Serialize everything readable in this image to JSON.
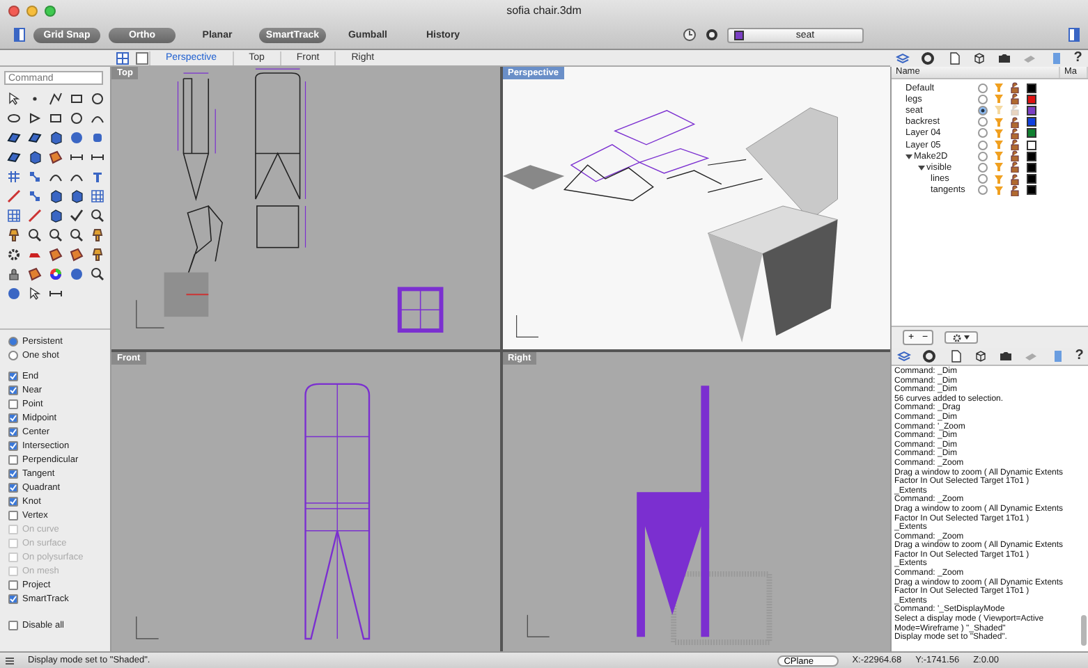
{
  "window": {
    "title": "sofia chair.3dm"
  },
  "toolbar": {
    "toggles": [
      {
        "label": "Grid Snap",
        "on": true
      },
      {
        "label": "Ortho",
        "on": true
      },
      {
        "label": "Planar",
        "on": false
      },
      {
        "label": "SmartTrack",
        "on": true
      },
      {
        "label": "Gumball",
        "on": false
      },
      {
        "label": "History",
        "on": false
      }
    ],
    "layer": {
      "name": "seat",
      "color": "#7b3fc4"
    }
  },
  "viewport_tabs": [
    {
      "label": "Perspective",
      "selected": true
    },
    {
      "label": "Top",
      "selected": false
    },
    {
      "label": "Front",
      "selected": false
    },
    {
      "label": "Right",
      "selected": false
    }
  ],
  "panel_tabs_top": {
    "help": "?"
  },
  "command": {
    "placeholder": "Command"
  },
  "osnaps": {
    "modes": [
      {
        "label": "Persistent",
        "selected": true
      },
      {
        "label": "One shot",
        "selected": false
      }
    ],
    "items": [
      {
        "label": "End",
        "checked": true,
        "disabled": false
      },
      {
        "label": "Near",
        "checked": true,
        "disabled": false
      },
      {
        "label": "Point",
        "checked": false,
        "disabled": false
      },
      {
        "label": "Midpoint",
        "checked": true,
        "disabled": false
      },
      {
        "label": "Center",
        "checked": true,
        "disabled": false
      },
      {
        "label": "Intersection",
        "checked": true,
        "disabled": false
      },
      {
        "label": "Perpendicular",
        "checked": false,
        "disabled": false
      },
      {
        "label": "Tangent",
        "checked": true,
        "disabled": false
      },
      {
        "label": "Quadrant",
        "checked": true,
        "disabled": false
      },
      {
        "label": "Knot",
        "checked": true,
        "disabled": false
      },
      {
        "label": "Vertex",
        "checked": false,
        "disabled": false
      },
      {
        "label": "On curve",
        "checked": false,
        "disabled": true
      },
      {
        "label": "On surface",
        "checked": false,
        "disabled": true
      },
      {
        "label": "On polysurface",
        "checked": false,
        "disabled": true
      },
      {
        "label": "On mesh",
        "checked": false,
        "disabled": true
      },
      {
        "label": "Project",
        "checked": false,
        "disabled": false
      },
      {
        "label": "SmartTrack",
        "checked": true,
        "disabled": false
      }
    ],
    "disable_all": {
      "label": "Disable all",
      "checked": false
    }
  },
  "viewports": [
    {
      "title": "Top",
      "kind": "top",
      "active": false
    },
    {
      "title": "Perspective",
      "kind": "perspective",
      "active": true
    },
    {
      "title": "Front",
      "kind": "front",
      "active": false
    },
    {
      "title": "Right",
      "kind": "right",
      "active": false
    }
  ],
  "layers": {
    "columns": [
      "Name",
      "Ma"
    ],
    "items": [
      {
        "name": "Default",
        "current": false,
        "color": "#000000"
      },
      {
        "name": "legs",
        "current": false,
        "color": "#e01010"
      },
      {
        "name": "seat",
        "current": true,
        "color": "#7b3fc4"
      },
      {
        "name": "backrest",
        "current": false,
        "color": "#1040e0"
      },
      {
        "name": "Layer 04",
        "current": false,
        "color": "#108030"
      },
      {
        "name": "Layer 05",
        "current": false,
        "color": "#ffffff"
      },
      {
        "name": "Make2D",
        "current": false,
        "color": "#000000",
        "expanded": true,
        "children": [
          {
            "name": "visible",
            "current": false,
            "color": "#000000",
            "expanded": true,
            "children": [
              {
                "name": "lines",
                "current": false,
                "color": "#000000"
              },
              {
                "name": "tangents",
                "current": false,
                "color": "#000000"
              }
            ]
          }
        ]
      }
    ],
    "buttons": [
      "+",
      "−"
    ]
  },
  "panel_tabs_bottom": {
    "help": "?"
  },
  "command_history": [
    "Command: _Dim",
    "Command: _Dim",
    "Command: _Dim",
    "56 curves added to selection.",
    "Command: _Drag",
    "Command: _Dim",
    "Command: '_Zoom",
    "Command: _Dim",
    "Command: _Dim",
    "Command: _Dim",
    "Command: _Zoom",
    "Drag a window to zoom ( All Dynamic Extents",
    "Factor In Out Selected Target 1To1 )",
    "_Extents",
    "Command: _Zoom",
    "Drag a window to zoom ( All Dynamic Extents",
    "Factor In Out Selected Target 1To1 )",
    "_Extents",
    "Command: _Zoom",
    "Drag a window to zoom ( All Dynamic Extents",
    "Factor In Out Selected Target 1To1 )",
    "_Extents",
    "Command: _Zoom",
    "Drag a window to zoom ( All Dynamic Extents",
    "Factor In Out Selected Target 1To1 )",
    "_Extents",
    "Command: '_SetDisplayMode",
    "Select a display mode ( Viewport=Active",
    "Mode=Wireframe ) \"_Shaded\"",
    "Display mode set to \"Shaded\"."
  ],
  "status_bar": {
    "message": "Display mode set to \"Shaded\".",
    "cplane": "CPlane",
    "x": "X:-22964.68",
    "y": "Y:-1741.56",
    "z": "Z:0.00"
  }
}
